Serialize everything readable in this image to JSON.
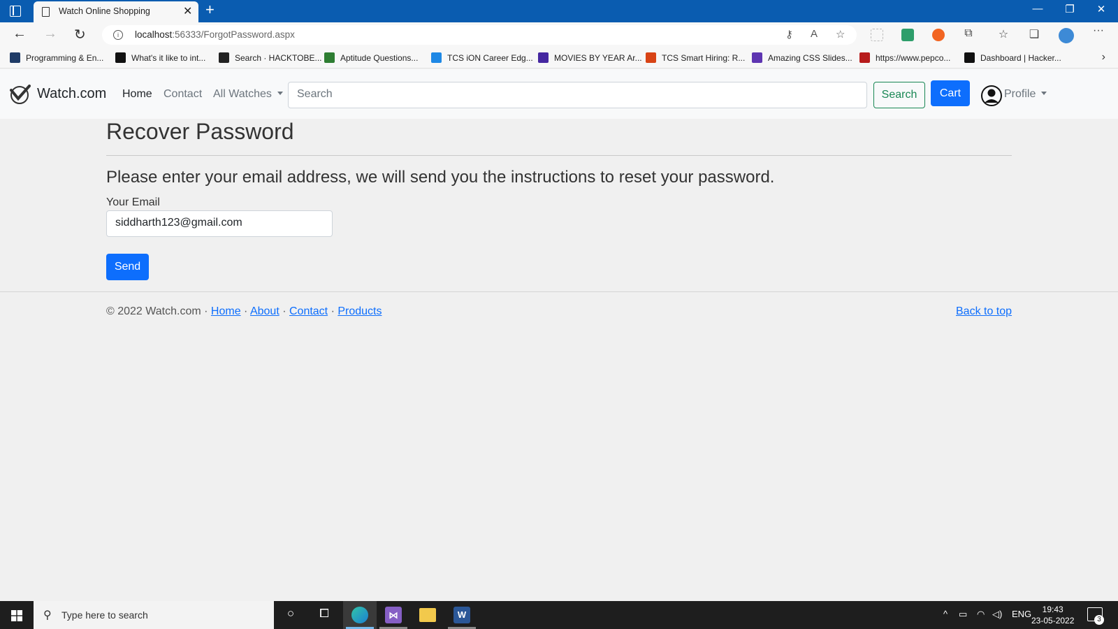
{
  "browser": {
    "tab_title": "Watch Online Shopping",
    "url_host": "localhost",
    "url_rest": ":56333/ForgotPassword.aspx",
    "bookmarks": [
      {
        "label": "Programming & En...",
        "icon": "bookmark-programming-icon",
        "color": "#1f3b66"
      },
      {
        "label": "What's it like to int...",
        "icon": "amazon-icon",
        "color": "#111111"
      },
      {
        "label": "Search · HACKTOBE...",
        "icon": "github-icon",
        "color": "#222222"
      },
      {
        "label": "Aptitude Questions...",
        "icon": "aptitude-icon",
        "color": "#2e7d32"
      },
      {
        "label": "TCS iON Career Edg...",
        "icon": "tcs-ion-icon",
        "color": "#1e88e5"
      },
      {
        "label": "MOVIES BY YEAR Ar...",
        "icon": "medium-icon",
        "color": "#4527a0"
      },
      {
        "label": "TCS Smart Hiring: R...",
        "icon": "tcs-icon",
        "color": "#d84315"
      },
      {
        "label": "Amazing CSS Slides...",
        "icon": "codepen-icon",
        "color": "#5e35b1"
      },
      {
        "label": "https://www.pepco...",
        "icon": "pepcoding-icon",
        "color": "#b71c1c"
      },
      {
        "label": "Dashboard | Hacker...",
        "icon": "hackerrank-icon",
        "color": "#111111"
      }
    ]
  },
  "site": {
    "brand": "Watch.com",
    "nav": {
      "home": "Home",
      "contact": "Contact",
      "all_watches": "All Watches"
    },
    "search_placeholder": "Search",
    "search_button": "Search",
    "cart_button": "Cart",
    "profile": "Profile"
  },
  "page": {
    "title": "Recover Password",
    "instruction": "Please enter your email address, we will send you the instructions to reset your password.",
    "email_label": "Your Email",
    "email_value": "siddharth123@gmail.com",
    "send_button": "Send"
  },
  "footer": {
    "copyright": "© 2022 Watch.com",
    "sep": " · ",
    "links": {
      "home": "Home",
      "about": "About",
      "contact": "Contact",
      "products": "Products"
    },
    "back_to_top": "Back to top"
  },
  "taskbar": {
    "search_placeholder": "Type here to search",
    "lang": "ENG",
    "time": "19:43",
    "date": "23-05-2022",
    "notification_count": "3"
  },
  "colors": {
    "primary": "#0d6efd",
    "success": "#198754",
    "titlebar": "#0a5cb0"
  }
}
